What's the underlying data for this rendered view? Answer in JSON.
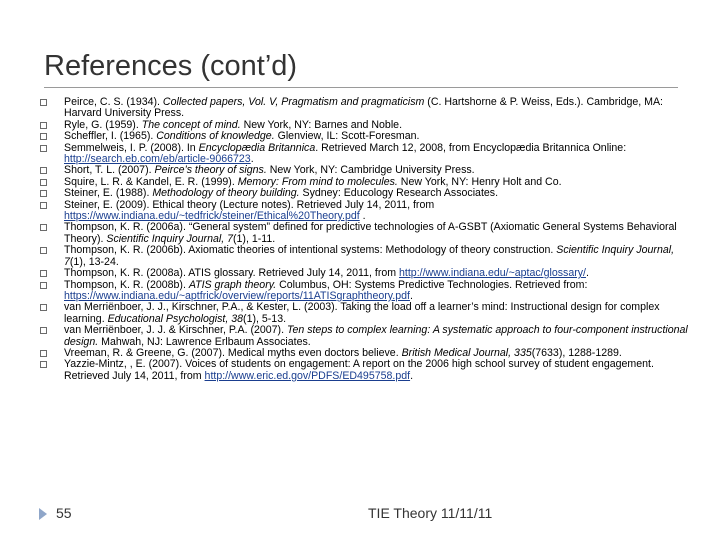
{
  "slide": {
    "title": "References (cont’d)",
    "page_number": "55",
    "footer": "TIE Theory 11/11/11"
  },
  "refs": [
    {
      "a": "Peirce, C. S. (1934). ",
      "i": "Collected papers, Vol. V, Pragmatism and pragmaticism",
      "b": " (C. Hartshorne & P. Weiss, Eds.). Cambridge, MA: Harvard University Press.",
      "l": "",
      "c": ""
    },
    {
      "a": "Ryle, G. (1959). ",
      "i": "The concept of mind.",
      "b": " New York, NY: Barnes and Noble.",
      "l": "",
      "c": ""
    },
    {
      "a": "Scheffler, I. (1965). ",
      "i": "Conditions of knowledge.",
      "b": " Glenview, IL: Scott-Foresman.",
      "l": "",
      "c": ""
    },
    {
      "a": "Semmelweis, I. P. (2008). In ",
      "i": "Encyclopædia Britannica",
      "b": ". Retrieved March 12, 2008, from Encyclopædia Britannica Online: ",
      "l": "http://search.eb.com/eb/article-9066723",
      "c": "."
    },
    {
      "a": "Short, T. L. (2007). ",
      "i": "Peirce’s theory of signs.",
      "b": " New York, NY: Cambridge University Press.",
      "l": "",
      "c": ""
    },
    {
      "a": "Squire, L. R. & Kandel, E. R. (1999). ",
      "i": "Memory: From mind to molecules.",
      "b": " New York, NY: Henry Holt and Co.",
      "l": "",
      "c": ""
    },
    {
      "a": "Steiner, E. (1988). ",
      "i": "Methodology of theory building.",
      "b": " Sydney: Educology Research Associates.",
      "l": "",
      "c": ""
    },
    {
      "a": "Steiner, E. (2009). Ethical theory (Lecture notes). Retrieved July 14, 2011, from ",
      "i": "",
      "b": "",
      "l": "https://www.indiana.edu/~tedfrick/steiner/Ethical%20Theory.pdf",
      "c": " ."
    },
    {
      "a": "Thompson, K. R. (2006a). “General system” defined for predictive technologies of A-GSBT (Axiomatic General Systems Behavioral Theory). ",
      "i": "Scientific Inquiry Journal, 7",
      "b": "(1), 1-11.",
      "l": "",
      "c": ""
    },
    {
      "a": "Thompson, K. R. (2006b). Axiomatic theories of intentional systems: Methodology of theory construction. ",
      "i": "Scientific Inquiry Journal, 7",
      "b": "(1), 13-24.",
      "l": "",
      "c": ""
    },
    {
      "a": "Thompson, K. R. (2008a). ATIS glossary. Retrieved July 14, 2011, from ",
      "i": "",
      "b": "",
      "l": "http://www.indiana.edu/~aptac/glossary/",
      "c": "."
    },
    {
      "a": "Thompson, K. R. (2008b). ",
      "i": "ATIS graph theory.",
      "b": " Columbus, OH: Systems Predictive Technologies. Retrieved from: ",
      "l": "https://www.indiana.edu/~aptfrick/overview/reports/11ATISgraphtheory.pdf",
      "c": "."
    },
    {
      "a": "van Merriënboer, J. J., Kirschner, P.A., & Kester, L. (2003). Taking the load off a learner’s mind: Instructional design for complex learning. ",
      "i": "Educational Psychologist, 38",
      "b": "(1), 5-13.",
      "l": "",
      "c": ""
    },
    {
      "a": "van Merriënboer, J. J. & Kirschner, P.A. (2007). ",
      "i": "Ten steps to complex learning: A systematic approach to four-component instructional design.",
      "b": " Mahwah, NJ: Lawrence Erlbaum Associates.",
      "l": "",
      "c": ""
    },
    {
      "a": "Vreeman, R. & Greene, G. (2007). Medical myths even doctors believe. ",
      "i": "British Medical Journal, 335",
      "b": "(7633), 1288-1289.",
      "l": "",
      "c": ""
    },
    {
      "a": "Yazzie-Mintz, , E. (2007). Voices of students on engagement: A report on the 2006 high school survey of student engagement. Retrieved July 14, 2011, from ",
      "i": "",
      "b": "",
      "l": "http://www.eric.ed.gov/PDFS/ED495758.pdf",
      "c": "."
    }
  ]
}
